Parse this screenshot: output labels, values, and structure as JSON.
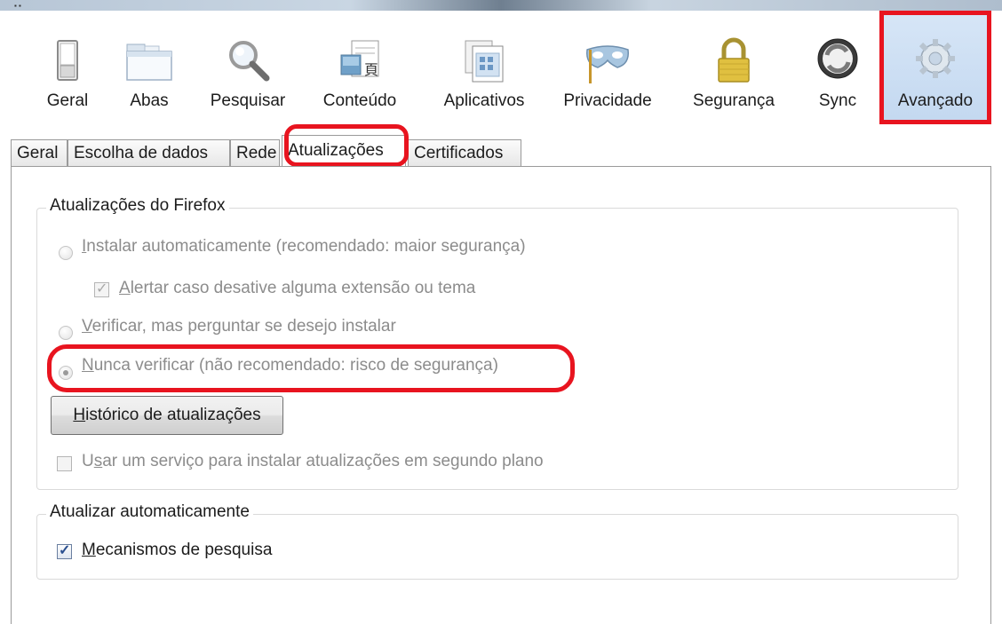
{
  "toolbar": {
    "items": [
      {
        "label": "Geral",
        "icon": "switch-icon"
      },
      {
        "label": "Abas",
        "icon": "tabs-window-icon"
      },
      {
        "label": "Pesquisar",
        "icon": "magnifier-icon"
      },
      {
        "label": "Conteúdo",
        "icon": "content-page-icon"
      },
      {
        "label": "Aplicativos",
        "icon": "applications-icon"
      },
      {
        "label": "Privacidade",
        "icon": "mask-icon"
      },
      {
        "label": "Segurança",
        "icon": "padlock-icon"
      },
      {
        "label": "Sync",
        "icon": "sync-icon"
      },
      {
        "label": "Avançado",
        "icon": "gear-icon",
        "selected": true
      }
    ]
  },
  "tabs": [
    "Geral",
    "Escolha de dados",
    "Rede",
    "Atualizações",
    "Certificados"
  ],
  "active_tab": "Atualizações",
  "updates_group": {
    "title": "Atualizações do Firefox",
    "option_auto": {
      "prefix": "I",
      "rest": "nstalar automaticamente (recomendado: maior segurança)"
    },
    "option_alert": {
      "prefix": "A",
      "rest": "lertar caso desative alguma extensão ou tema"
    },
    "option_check": {
      "prefix": "V",
      "rest": "erificar, mas perguntar se desejo instalar"
    },
    "option_never": {
      "prefix": "N",
      "rest": "unca verificar (não recomendado: risco de segurança)"
    },
    "history_button": {
      "prefix": "H",
      "rest": "istórico de atualizações"
    },
    "background_service": {
      "prefix": "U",
      "mid": "s",
      "rest": "ar um serviço para instalar atualizações em segundo plano"
    }
  },
  "auto_group": {
    "title": "Atualizar automaticamente",
    "search_engines": {
      "prefix": "M",
      "rest": "ecanismos de pesquisa"
    }
  },
  "colors": {
    "highlight_red": "#e8141f",
    "selected_bg": "#c9dcf1"
  }
}
